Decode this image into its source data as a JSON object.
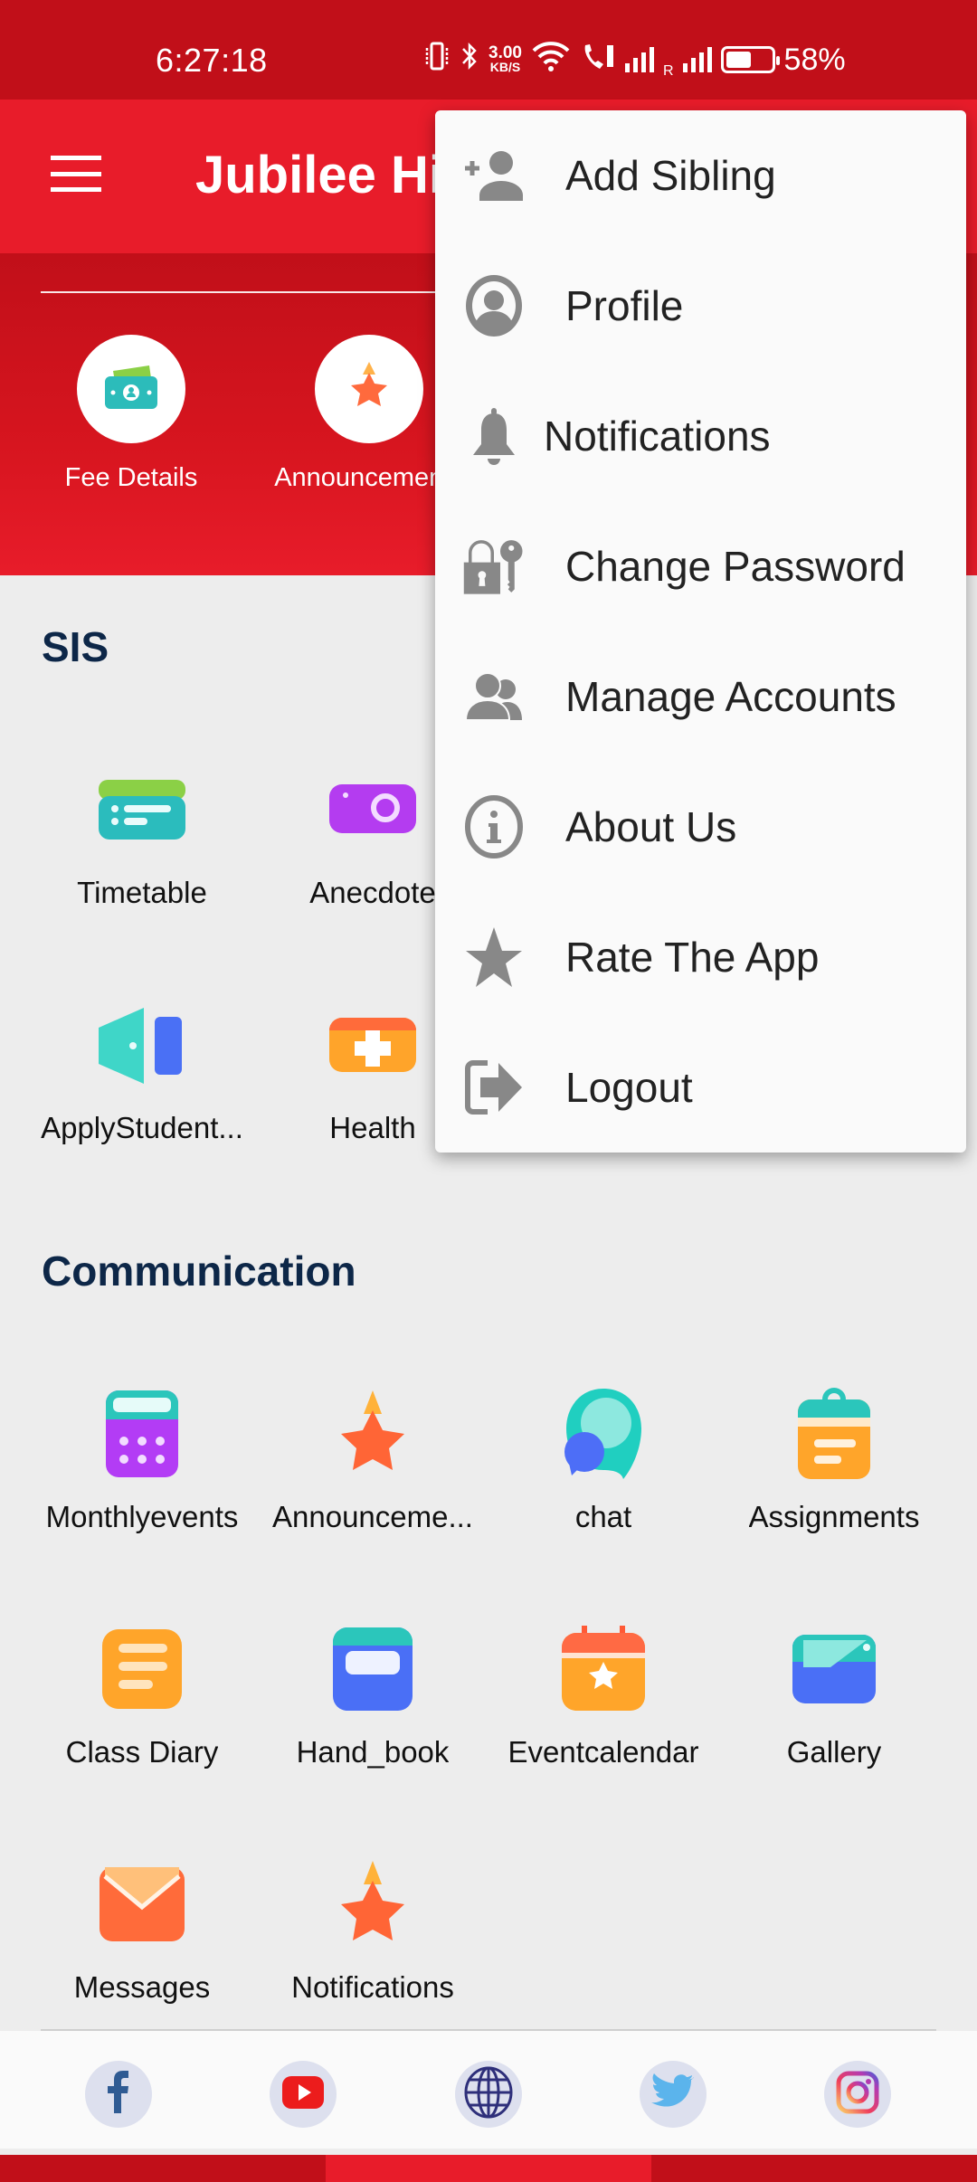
{
  "status_bar": {
    "time": "6:27:18",
    "net_speed_value": "3.00",
    "net_speed_unit": "KB/S",
    "battery_percent": "58%",
    "battery_level": 0.58,
    "sim2_label": "R"
  },
  "app_bar": {
    "title": "Jubilee Hills"
  },
  "quick_actions": [
    {
      "label": "Fee Details",
      "icon": "money-icon"
    },
    {
      "label": "Announcements",
      "icon": "star-icon"
    }
  ],
  "sections": [
    {
      "title": "SIS",
      "items": [
        {
          "label": "Timetable",
          "icon": "timetable-icon"
        },
        {
          "label": "Anecdote",
          "icon": "camera-icon"
        },
        {
          "label": "ApplyStudent...",
          "icon": "door-icon"
        },
        {
          "label": "Health",
          "icon": "first-aid-icon"
        }
      ]
    },
    {
      "title": "Communication",
      "items": [
        {
          "label": "Monthlyevents",
          "icon": "calendar-grid-icon"
        },
        {
          "label": "Announceme...",
          "icon": "star-icon"
        },
        {
          "label": "chat",
          "icon": "chat-icon"
        },
        {
          "label": "Assignments",
          "icon": "clipboard-icon"
        },
        {
          "label": "Class Diary",
          "icon": "diary-icon"
        },
        {
          "label": "Hand_book",
          "icon": "book-icon"
        },
        {
          "label": "Eventcalendar",
          "icon": "event-calendar-icon"
        },
        {
          "label": "Gallery",
          "icon": "gallery-icon"
        },
        {
          "label": "Messages",
          "icon": "envelope-icon"
        },
        {
          "label": "Notifications",
          "icon": "star-icon"
        }
      ]
    }
  ],
  "footer": {
    "social": [
      {
        "name": "facebook",
        "icon": "facebook-icon"
      },
      {
        "name": "youtube",
        "icon": "youtube-icon"
      },
      {
        "name": "website",
        "icon": "globe-icon"
      },
      {
        "name": "twitter",
        "icon": "twitter-icon"
      },
      {
        "name": "instagram",
        "icon": "instagram-icon"
      }
    ]
  },
  "overflow_menu": {
    "items": [
      {
        "label": "Add Sibling",
        "icon": "add-person-icon"
      },
      {
        "label": "Profile",
        "icon": "profile-icon"
      },
      {
        "label": "Notifications",
        "icon": "bell-icon"
      },
      {
        "label": "Change Password",
        "icon": "lock-key-icon"
      },
      {
        "label": "Manage Accounts",
        "icon": "accounts-icon"
      },
      {
        "label": "About Us",
        "icon": "info-icon"
      },
      {
        "label": "Rate The App",
        "icon": "star-icon"
      },
      {
        "label": "Logout",
        "icon": "logout-icon"
      }
    ]
  },
  "colors": {
    "status_bar": "#c10f19",
    "brand_red": "#e81c2a",
    "section_title": "#0d2748",
    "menu_icon_grey": "#888888"
  }
}
